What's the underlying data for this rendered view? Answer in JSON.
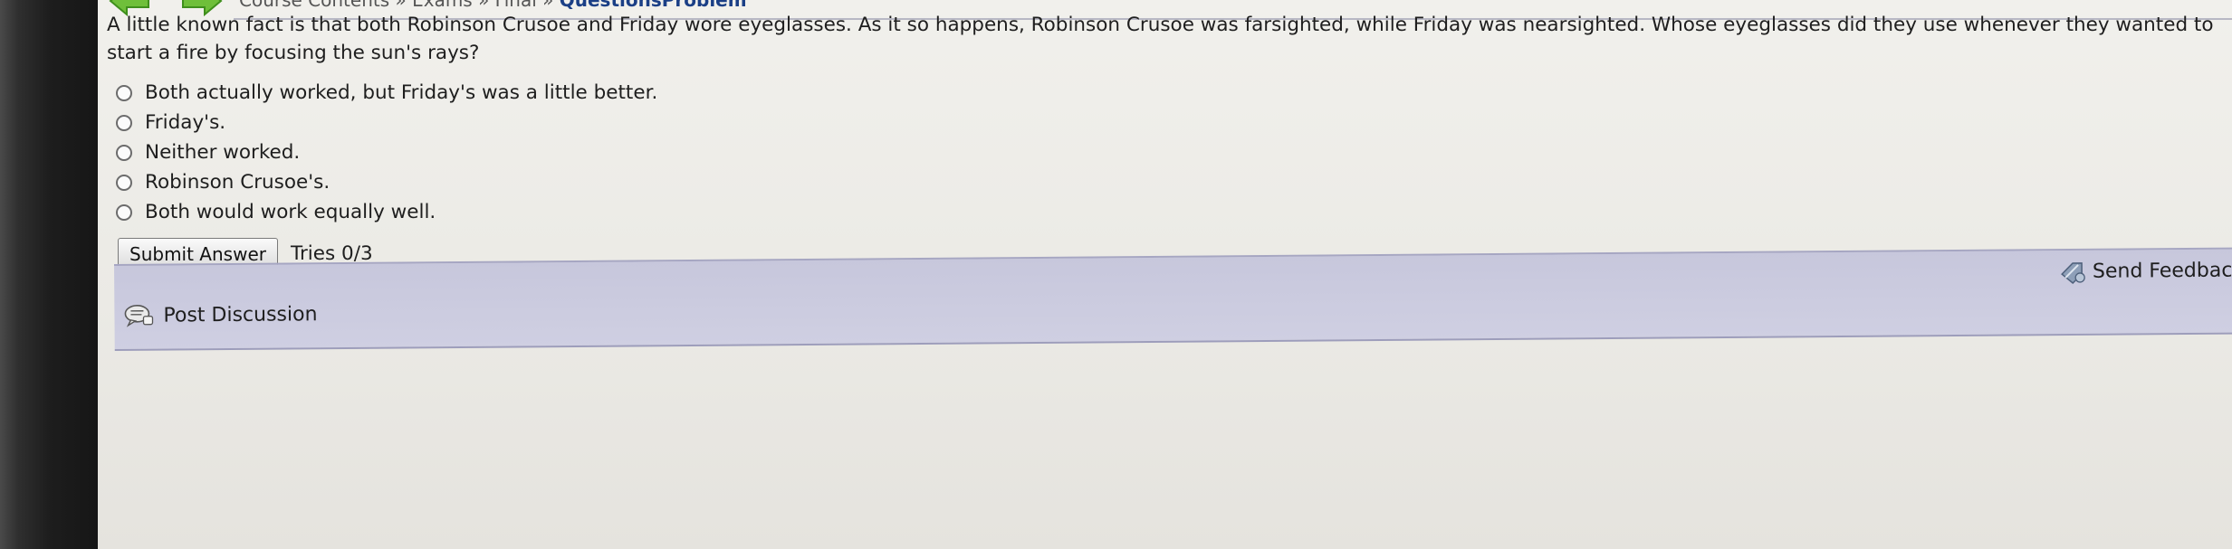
{
  "nav": {
    "breadcrumb_left": "Course Contents » Exams » Final » ",
    "breadcrumb_current": "QuestionsProblem"
  },
  "question": {
    "text": "A little known fact is that both Robinson Crusoe and Friday wore eyeglasses. As it so happens, Robinson Crusoe was farsighted, while Friday was nearsighted. Whose eyeglasses did they use whenever they wanted to start a fire by focusing the sun's rays?",
    "options": [
      "Both actually worked, but Friday's was a little better.",
      "Friday's.",
      "Neither worked.",
      "Robinson Crusoe's.",
      "Both would work equally well."
    ]
  },
  "actions": {
    "submit_label": "Submit Answer",
    "tries": "Tries 0/3"
  },
  "discussion": {
    "post_label": "Post Discussion",
    "feedback_label": "Send Feedback"
  },
  "icons": {
    "back": "green-back-arrow-icon",
    "forward": "green-forward-arrow-icon",
    "post": "discussion-bubble-icon",
    "feedback": "feedback-pencil-icon"
  },
  "colors": {
    "nav_arrow": "#6fbf3a",
    "breadcrumb_current": "#1b3f86",
    "discussion_bar": "#c9c9dd"
  }
}
